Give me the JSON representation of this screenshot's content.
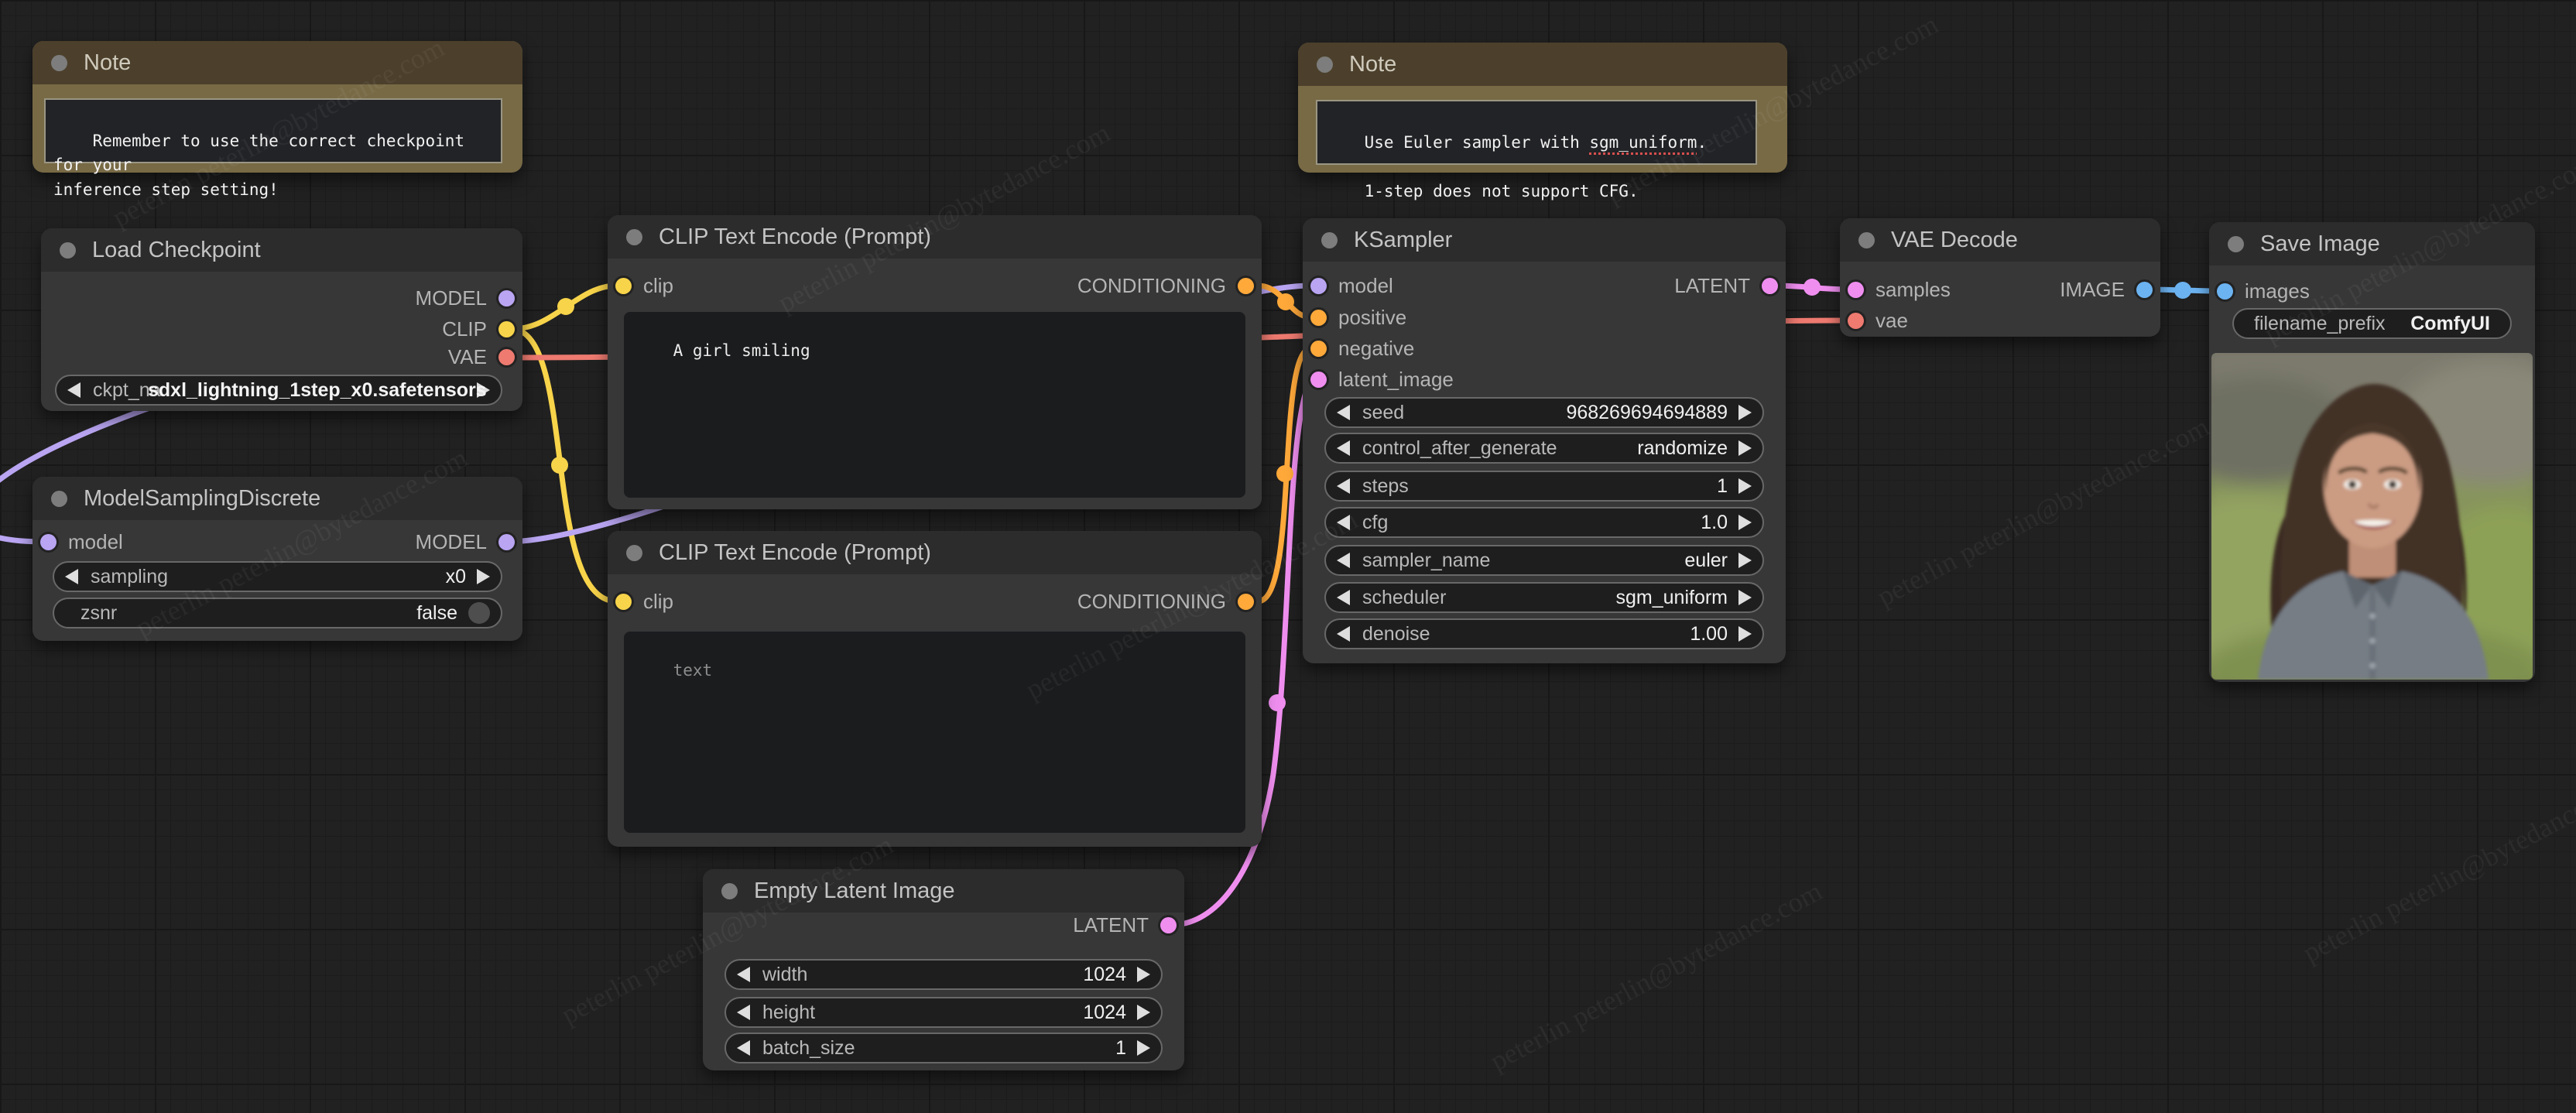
{
  "watermark": {
    "text": "peterlin peterlin@bytedance.com"
  },
  "colors": {
    "model": "#b9a5f2",
    "clip": "#f8d44a",
    "vae": "#ee7a70",
    "conditioning": "#ffa93a",
    "latent": "#f08ef0",
    "image": "#6cb3f1",
    "note_title": "#4c402c",
    "note_body": "#786a45",
    "node_body": "#373737",
    "node_title": "#2c2c2c",
    "canvas": "#212121"
  },
  "nodes": {
    "note1": {
      "title": "Note",
      "text": "Remember to use the correct checkpoint for your\ninference step setting!"
    },
    "load_checkpoint": {
      "title": "Load Checkpoint",
      "outputs": [
        "MODEL",
        "CLIP",
        "VAE"
      ],
      "widget": {
        "label": "ckpt_na",
        "value": "sdxl_lightning_1step_x0.safetensors"
      }
    },
    "model_sampling": {
      "title": "ModelSamplingDiscrete",
      "inputs": [
        "model"
      ],
      "outputs": [
        "MODEL"
      ],
      "widgets": [
        {
          "label": "sampling",
          "value": "x0"
        },
        {
          "label": "zsnr",
          "value": "false"
        }
      ]
    },
    "clip_positive": {
      "title": "CLIP Text Encode (Prompt)",
      "inputs": [
        "clip"
      ],
      "outputs": [
        "CONDITIONING"
      ],
      "text": "A girl smiling"
    },
    "clip_negative": {
      "title": "CLIP Text Encode (Prompt)",
      "inputs": [
        "clip"
      ],
      "outputs": [
        "CONDITIONING"
      ],
      "placeholder": "text"
    },
    "empty_latent": {
      "title": "Empty Latent Image",
      "outputs": [
        "LATENT"
      ],
      "widgets": [
        {
          "label": "width",
          "value": "1024"
        },
        {
          "label": "height",
          "value": "1024"
        },
        {
          "label": "batch_size",
          "value": "1"
        }
      ]
    },
    "note2": {
      "title": "Note",
      "t1": "Use Euler sampler with ",
      "t1_misspelled": "sgm_uniform",
      "t1_end": ".",
      "t2": "1-step does not support CFG."
    },
    "ksampler": {
      "title": "KSampler",
      "inputs": [
        "model",
        "positive",
        "negative",
        "latent_image"
      ],
      "outputs": [
        "LATENT"
      ],
      "widgets": [
        {
          "label": "seed",
          "value": "968269694694889"
        },
        {
          "label": "control_after_generate",
          "value": "randomize"
        },
        {
          "label": "steps",
          "value": "1"
        },
        {
          "label": "cfg",
          "value": "1.0"
        },
        {
          "label": "sampler_name",
          "value": "euler"
        },
        {
          "label": "scheduler",
          "value": "sgm_uniform"
        },
        {
          "label": "denoise",
          "value": "1.00"
        }
      ]
    },
    "vae_decode": {
      "title": "VAE Decode",
      "inputs": [
        "samples",
        "vae"
      ],
      "outputs": [
        "IMAGE"
      ]
    },
    "save_image": {
      "title": "Save Image",
      "inputs": [
        "images"
      ],
      "widget": {
        "label": "filename_prefix",
        "value": "ComfyUI"
      }
    }
  }
}
